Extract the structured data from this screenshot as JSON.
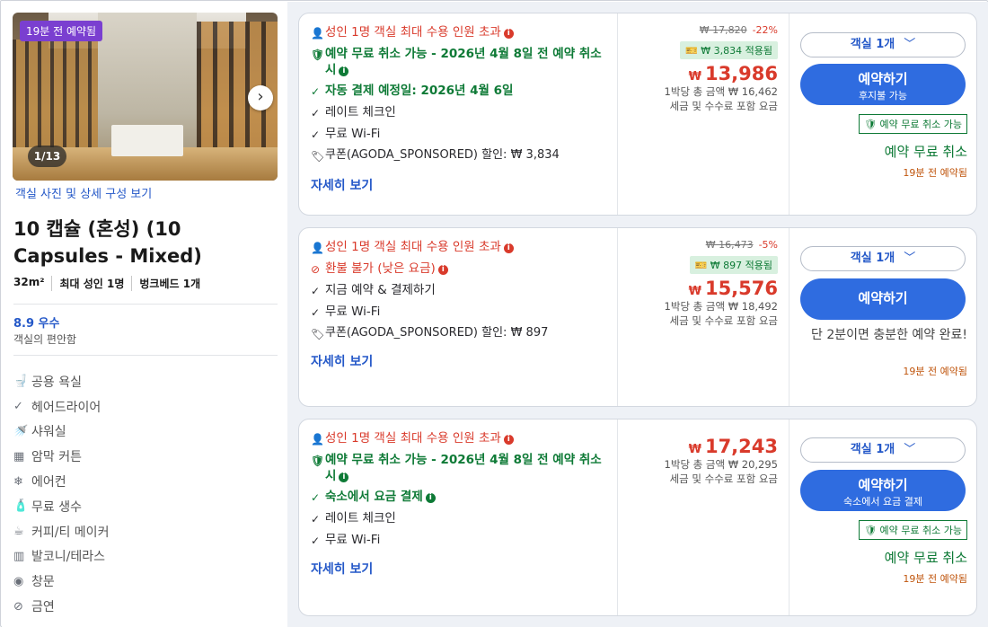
{
  "left": {
    "badge": "19분 전 예약됨",
    "counter": "1/13",
    "photo_link": "객실 사진 및 상세 구성 보기",
    "title": "10 캡슐 (혼성) (10 Capsules - Mixed)",
    "specs": [
      "32m²",
      "최대 성인 1명",
      "벙크베드 1개"
    ],
    "rating": "8.9 우수",
    "rating_sub": "객실의 편안함",
    "amenities": [
      {
        "icon": "toilet-icon",
        "glyph": "🚽",
        "label": "공용 욕실"
      },
      {
        "icon": "check-icon",
        "glyph": "✓",
        "label": "헤어드라이어"
      },
      {
        "icon": "shower-icon",
        "glyph": "🚿",
        "label": "샤워실"
      },
      {
        "icon": "curtain-icon",
        "glyph": "▦",
        "label": "암막 커튼"
      },
      {
        "icon": "snowflake-icon",
        "glyph": "❄",
        "label": "에어컨"
      },
      {
        "icon": "bottle-icon",
        "glyph": "🧴",
        "label": "무료 생수"
      },
      {
        "icon": "cup-icon",
        "glyph": "☕",
        "label": "커피/티 메이커"
      },
      {
        "icon": "balcony-icon",
        "glyph": "▥",
        "label": "발코니/테라스"
      },
      {
        "icon": "window-icon",
        "glyph": "◉",
        "label": "창문"
      },
      {
        "icon": "no-smoking-icon",
        "glyph": "⊘",
        "label": "금연"
      }
    ]
  },
  "cards": [
    {
      "capacity": "성인 1명 객실 최대 수용 인원 초과",
      "policy": "예약 무료 취소 가능 - 2026년 4월 8일 전 예약 취소 시",
      "payment": "자동 결제 예정일: 2026년 4월 6일",
      "feature1": "레이트 체크인",
      "feature2": "무료 Wi-Fi",
      "coupon": "쿠폰(AGODA_SPONSORED) 할인: ₩ 3,834",
      "more": "자세히 보기",
      "orig_price": "₩ 17,820",
      "discount": "-22%",
      "applied": "₩ 3,834 적용됨",
      "currency": "₩",
      "price": "13,986",
      "total": "1박당 총 금액 ₩ 16,462",
      "tax": "세금 및 수수료 포함 요금",
      "qty": "객실 1개",
      "book": "예약하기",
      "book_sub": "후지불 가능",
      "fc_tag": "예약 무료 취소 가능",
      "fc_big": "예약 무료 취소",
      "booked": "19분 전 예약됨"
    },
    {
      "capacity": "성인 1명 객실 최대 수용 인원 초과",
      "policy": "환불 불가 (낮은 요금)",
      "payment": "지금 예약 & 결제하기",
      "feature1": "무료 Wi-Fi",
      "coupon": "쿠폰(AGODA_SPONSORED) 할인: ₩ 897",
      "more": "자세히 보기",
      "orig_price": "₩ 16,473",
      "discount": "-5%",
      "applied": "₩ 897 적용됨",
      "currency": "₩",
      "price": "15,576",
      "total": "1박당 총 금액 ₩ 18,492",
      "tax": "세금 및 수수료 포함 요금",
      "qty": "객실 1개",
      "book": "예약하기",
      "hint": "단 2분이면 충분한 예약 완료!",
      "booked": "19분 전 예약됨"
    },
    {
      "capacity": "성인 1명 객실 최대 수용 인원 초과",
      "policy": "예약 무료 취소 가능 - 2026년 4월 8일 전 예약 취소 시",
      "payment": "숙소에서 요금 결제",
      "feature1": "레이트 체크인",
      "feature2": "무료 Wi-Fi",
      "more": "자세히 보기",
      "currency": "₩",
      "price": "17,243",
      "total": "1박당 총 금액 ₩ 20,295",
      "tax": "세금 및 수수료 포함 요금",
      "qty": "객실 1개",
      "book": "예약하기",
      "book_sub": "숙소에서 요금 결제",
      "fc_tag": "예약 무료 취소 가능",
      "fc_big": "예약 무료 취소",
      "booked": "19분 전 예약됨"
    }
  ]
}
